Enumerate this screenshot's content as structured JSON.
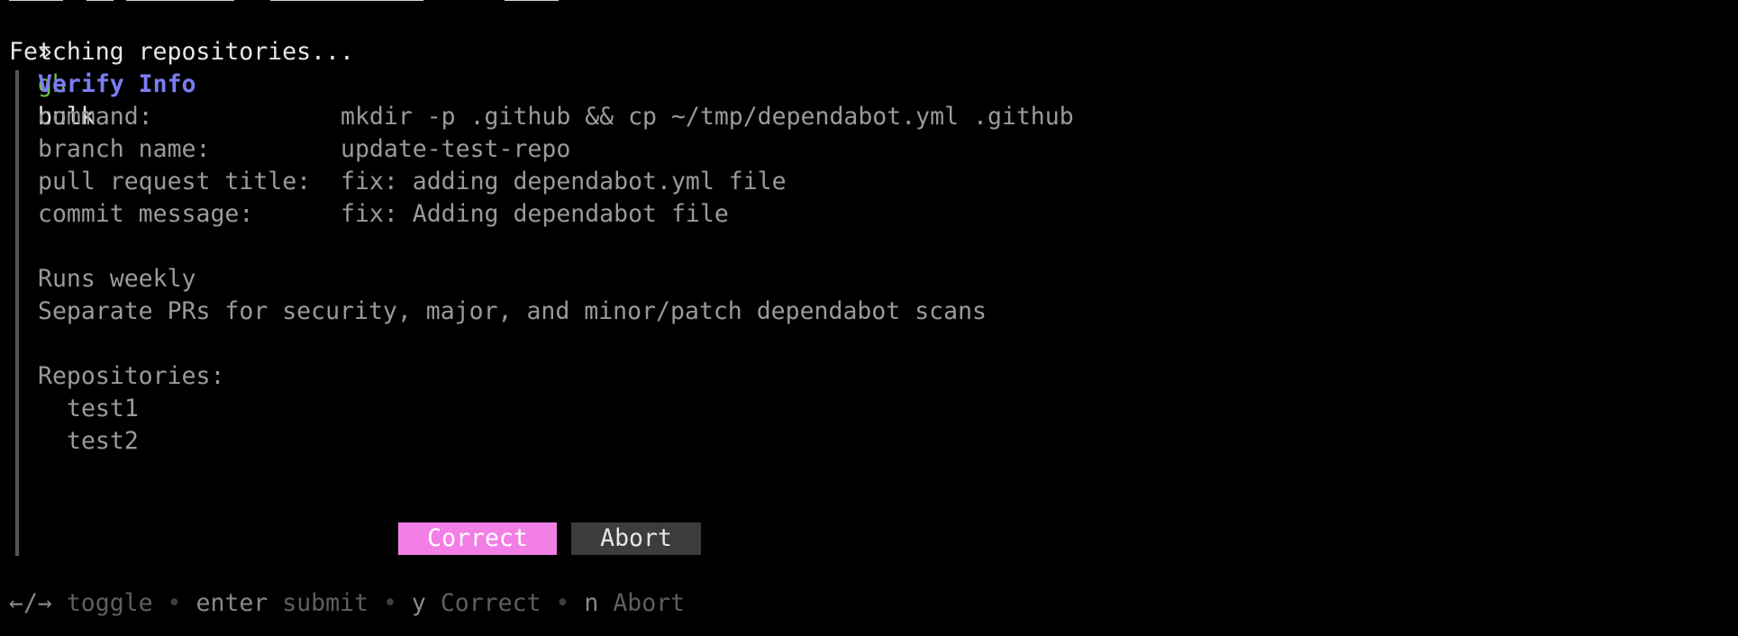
{
  "prompt": {
    "symbol": "»",
    "command_name": "gh",
    "command_args": "bulk"
  },
  "status_line": "Fetching repositories...",
  "panel": {
    "title": "Verify Info",
    "fields": [
      {
        "label": "command:",
        "value": "mkdir -p .github && cp ~/tmp/dependabot.yml .github"
      },
      {
        "label": "branch name:",
        "value": "update-test-repo"
      },
      {
        "label": "pull request title:",
        "value": "fix: adding dependabot.yml file"
      },
      {
        "label": "commit message:",
        "value": "fix: Adding dependabot file"
      }
    ],
    "description_lines": [
      "Runs weekly",
      "Separate PRs for security, major, and minor/patch dependabot scans"
    ],
    "repositories_heading": "Repositories:",
    "repositories": [
      "test1",
      "test2"
    ]
  },
  "buttons": {
    "correct": "Correct",
    "abort": "Abort"
  },
  "help": {
    "toggle_key": "←/→",
    "toggle_desc": "toggle",
    "submit_key": "enter",
    "submit_desc": "submit",
    "correct_key": "y",
    "correct_desc": "Correct",
    "abort_key": "n",
    "abort_desc": "Abort",
    "separator": "•"
  },
  "colors": {
    "background": "#000000",
    "prompt_command": "#6cc24a",
    "title": "#7c7cf2",
    "correct_button": "#f27ee6",
    "abort_button": "#3c3c3c"
  }
}
